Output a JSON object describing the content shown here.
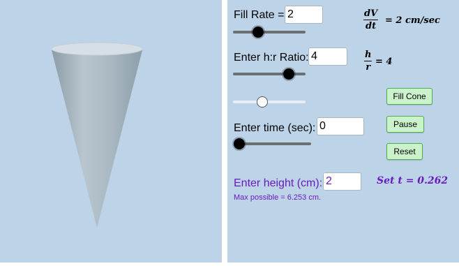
{
  "fill_rate": {
    "label": "Fill Rate =",
    "value": "2",
    "slider_level": 0.35
  },
  "ratio": {
    "label": "Enter h:r Ratio:",
    "value": "4",
    "slider_level": 0.77
  },
  "unlabeled_slider": {
    "level": 0.4
  },
  "time": {
    "label": "Enter time (sec):",
    "value": "0",
    "slider_level": 0.0
  },
  "height": {
    "label": "Enter height (cm):",
    "value": "2",
    "max_note": "Max possible = 6.253 cm."
  },
  "buttons": {
    "fill_cone": "Fill Cone",
    "pause": "Pause",
    "reset": "Reset"
  },
  "formulas": {
    "rate_num": "dV",
    "rate_den": "dt",
    "rate_rhs": "= 2 cm/sec",
    "ratio_num": "h",
    "ratio_den": "r",
    "ratio_rhs": "= 4",
    "set_t": "Set t = 0.262"
  },
  "colors": {
    "background": "#bcd3e8",
    "accent_purple": "#6a1bbf",
    "button_fill": "#ccf2cc",
    "cone": "#9fb0bc"
  }
}
